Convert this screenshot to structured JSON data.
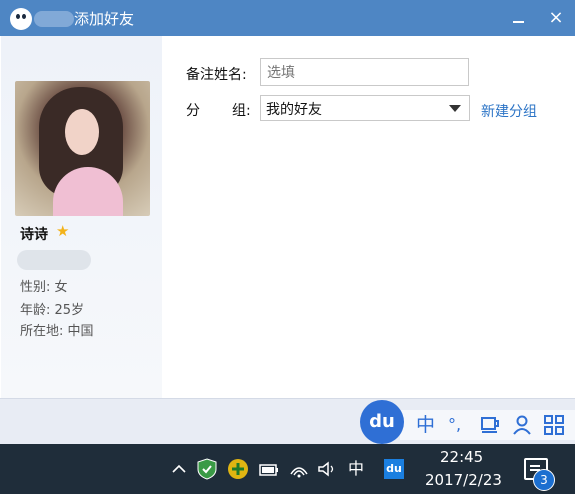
{
  "window": {
    "title": "添加好友",
    "minimize_label": "",
    "close_label": "×"
  },
  "profile": {
    "nickname": "诗诗",
    "gender": "性别: 女",
    "age": "年龄: 25岁",
    "location": "所在地: 中国"
  },
  "form": {
    "remark_label": "备注姓名:",
    "remark_placeholder": "选填",
    "group_label_a": "分",
    "group_label_b": "组:",
    "group_value": "我的好友",
    "new_group_link": "新建分组"
  },
  "ime": {
    "logo": "du",
    "chinese_mode": "中",
    "punctuation": "°,",
    "icons": [
      "cup-icon",
      "user-icon",
      "grid-icon"
    ]
  },
  "taskbar": {
    "lang": "中",
    "tray_app": "du",
    "time": "22:45",
    "date": "2017/2/23",
    "notification_count": "3"
  }
}
